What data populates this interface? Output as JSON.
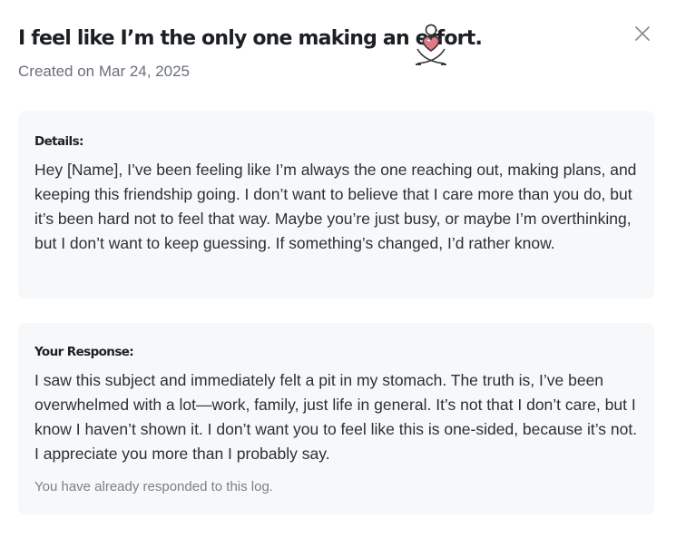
{
  "header": {
    "title": "I feel like I’m the only one making an effort.",
    "created": "Created on Mar 24, 2025"
  },
  "icons": {
    "mascot": "sitting-figure-holding-heart-icon",
    "close": "close-icon"
  },
  "details": {
    "label": "Details:",
    "body": "Hey [Name], I’ve been feeling like I’m always the one reaching out, making plans, and keeping this friendship going. I don’t want to believe that I care more than you do, but it’s been hard not to feel that way. Maybe you’re just busy, or maybe I’m overthinking, but I don’t want to keep guessing. If something’s changed, I’d rather know."
  },
  "response": {
    "label": "Your Response:",
    "body": "I saw this subject and immediately felt a pit in my stomach. The truth is, I’ve been overwhelmed with a lot—work, family, just life in general. It’s not that I don’t care, but I know I haven’t shown it. I don’t want you to feel like this is one-sided, because it’s not. I appreciate you more than I probably say.",
    "note": "You have already responded to this log."
  },
  "colors": {
    "card_background": "#f7f8fa",
    "heart": "#e07b86",
    "text_primary": "#1c1f24",
    "text_muted": "#7a7f88"
  }
}
